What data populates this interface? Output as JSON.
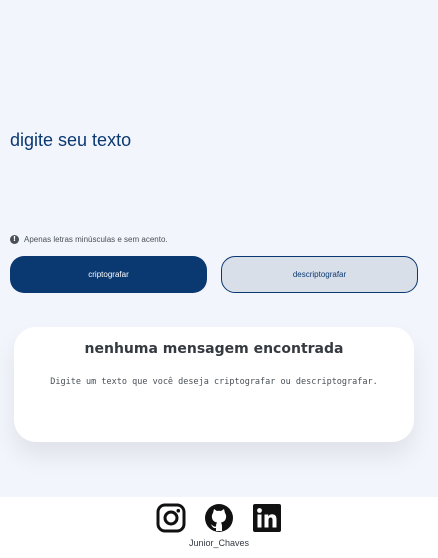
{
  "input": {
    "placeholder": "digite seu texto"
  },
  "hint": {
    "icon": "info-icon",
    "icon_glyph": "!",
    "text": "Apenas letras minúsculas e sem acento."
  },
  "buttons": {
    "encrypt_label": "criptografar",
    "decrypt_label": "descriptografar"
  },
  "output": {
    "title": "nenhuma mensagem encontrada",
    "message": "Digite um texto que você deseja criptografar ou descriptografar."
  },
  "footer": {
    "links": [
      {
        "icon": "instagram-icon"
      },
      {
        "icon": "github-icon"
      },
      {
        "icon": "linkedin-icon"
      }
    ],
    "author": "Junior_Chaves"
  },
  "colors": {
    "primary": "#0a3871",
    "background": "#f3f5fc",
    "secondary_button": "#d8dfe8"
  }
}
